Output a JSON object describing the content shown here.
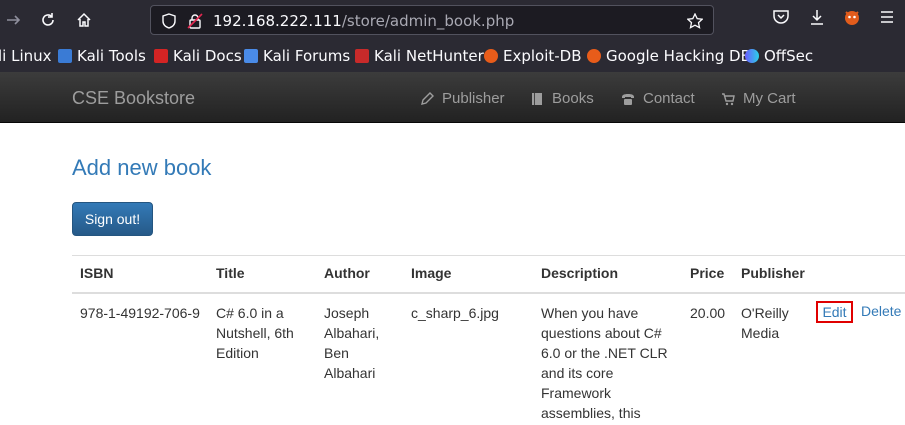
{
  "browser": {
    "url_host": "192.168.222.111",
    "url_path": "/store/admin_book.php"
  },
  "bookmarks": [
    {
      "label": "li Linux",
      "icon": "kali-linux-icon"
    },
    {
      "label": "Kali Tools",
      "icon": "kali-tools-icon"
    },
    {
      "label": "Kali Docs",
      "icon": "kali-docs-icon"
    },
    {
      "label": "Kali Forums",
      "icon": "kali-forums-icon"
    },
    {
      "label": "Kali NetHunter",
      "icon": "kali-nethunter-icon"
    },
    {
      "label": "Exploit-DB",
      "icon": "exploit-db-icon"
    },
    {
      "label": "Google Hacking DB",
      "icon": "ghdb-icon"
    },
    {
      "label": "OffSec",
      "icon": "offsec-icon"
    }
  ],
  "site": {
    "brand": "CSE Bookstore",
    "nav": [
      {
        "label": "Publisher",
        "icon": "pencil-icon"
      },
      {
        "label": "Books",
        "icon": "book-icon"
      },
      {
        "label": "Contact",
        "icon": "phone-icon"
      },
      {
        "label": "My Cart",
        "icon": "cart-icon"
      }
    ]
  },
  "main": {
    "heading": "Add new book",
    "signout_label": "Sign out!",
    "table": {
      "headers": [
        "ISBN",
        "Title",
        "Author",
        "Image",
        "Description",
        "Price",
        "Publisher"
      ],
      "rows": [
        {
          "isbn": "978-1-49192-706-9",
          "title": "C# 6.0 in a Nutshell, 6th Edition",
          "author": "Joseph Albahari, Ben Albahari",
          "image": "c_sharp_6.jpg",
          "description": "When you have questions about C# 6.0 or the .NET CLR and its core Framework assemblies, this",
          "price": "20.00",
          "publisher": "O'Reilly Media",
          "edit_label": "Edit",
          "delete_label": "Delete"
        }
      ]
    }
  },
  "colors": {
    "link": "#337ab7",
    "highlight_border": "#e00000",
    "navbar": "#222222"
  }
}
